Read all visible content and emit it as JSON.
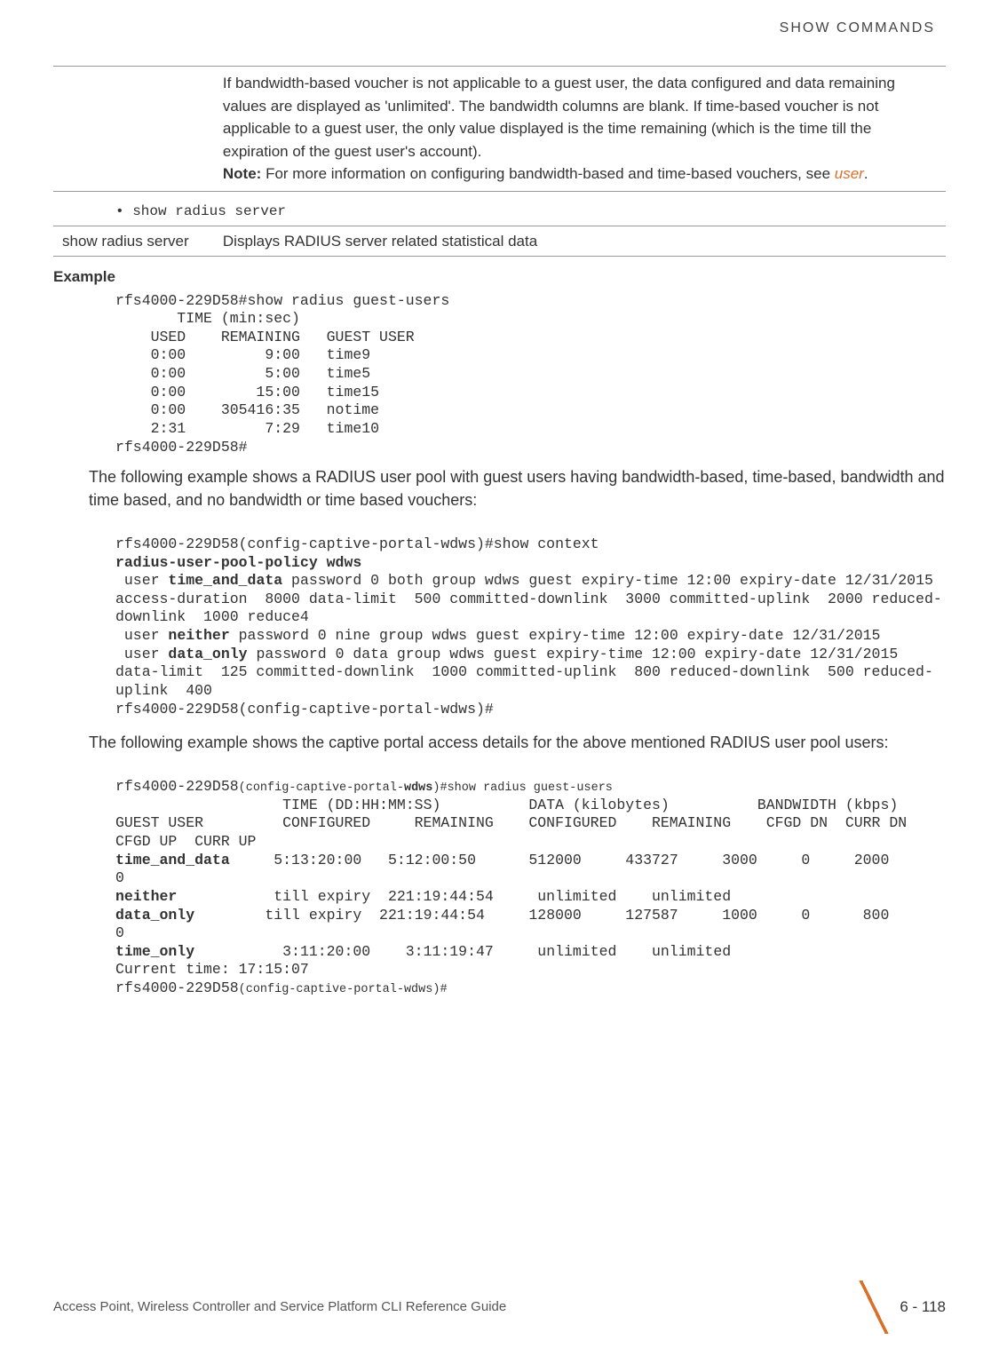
{
  "header": {
    "title": "SHOW COMMANDS"
  },
  "topbox": {
    "p1": "If bandwidth-based voucher is not applicable to a guest user, the data configured and data remaining values are displayed as 'unlimited'. The bandwidth columns are blank. If time-based voucher is not applicable to a guest user, the only value displayed is the time remaining (which is the time till the expiration of the guest user's account).",
    "note_label": "Note:",
    "note_text": " For more information on configuring bandwidth-based and time-based vouchers, see ",
    "note_link": "user",
    "note_tail": "."
  },
  "bullet": {
    "text": "• show radius server"
  },
  "radius_row": {
    "left": "show radius server",
    "right": "Displays RADIUS server related statistical data"
  },
  "example_label": "Example",
  "block1": "rfs4000-229D58#show radius guest-users\n       TIME (min:sec)\n    USED    REMAINING   GUEST USER\n    0:00         9:00   time9\n    0:00         5:00   time5\n    0:00        15:00   time15\n    0:00    305416:35   notime\n    2:31         7:29   time10\nrfs4000-229D58#",
  "body1": "The following example shows a RADIUS user pool with guest users having bandwidth-based, time-based, bandwidth and time based, and no bandwidth or time based vouchers:",
  "block2_line1": "rfs4000-229D58(config-captive-portal-wdws)#show context",
  "block2_line2": "radius-user-pool-policy wdws",
  "block2_user1_a": " user ",
  "block2_user1_b": "time_and_data",
  "block2_user1_c": " password 0 both group wdws guest expiry-time 12:00 expiry-date 12/31/2015 access-duration  8000 data-limit  500 committed-downlink  3000 committed-uplink  2000 reduced-downlink  1000 reduce4",
  "block2_user2_a": " user ",
  "block2_user2_b": "neither",
  "block2_user2_c": " password 0 nine group wdws guest expiry-time 12:00 expiry-date 12/31/2015",
  "block2_user3_a": " user ",
  "block2_user3_b": "data_only",
  "block2_user3_c": " password 0 data group wdws guest expiry-time 12:00 expiry-date 12/31/2015 data-limit  125 committed-downlink  1000 committed-uplink  800 reduced-downlink  500 reduced-uplink  400",
  "block2_tail": "rfs4000-229D58(config-captive-portal-wdws)#",
  "body2": "The following example shows the captive portal access details for the above mentioned RADIUS user pool users:",
  "block3_prefix": "rfs4000-229D58",
  "block3_small1": "(config-captive-portal-",
  "block3_small_bold": "wdws",
  "block3_small2": ")#show radius guest-users",
  "block3_header1": "                   TIME (DD:HH:MM:SS)          DATA (kilobytes)          BANDWIDTH (kbps)",
  "block3_header2": "GUEST USER         CONFIGURED     REMAINING    CONFIGURED    REMAINING    CFGD DN  CURR DN  CFGD UP  CURR UP",
  "row_tad_a": "time_and_data",
  "row_tad_b": "     5:13:20:00   5:12:00:50      512000     433727     3000     0     2000       0",
  "row_neither_a": "neither",
  "row_neither_b": "           till expiry  221:19:44:54     unlimited    unlimited",
  "row_dataonly_a": "data_only",
  "row_dataonly_b": "        till expiry  221:19:44:54     128000     127587     1000     0      800        0",
  "row_timeonly_a": "time_only",
  "row_timeonly_b": "          3:11:20:00    3:11:19:47     unlimited    unlimited",
  "block3_time": "Current time: 17:15:07",
  "block3_tail_prefix": "rfs4000-229D58",
  "block3_tail_small": "(config-captive-portal-wdws)#",
  "footer": {
    "left": "Access Point, Wireless Controller and Service Platform CLI Reference Guide",
    "page": "6 - 118"
  }
}
